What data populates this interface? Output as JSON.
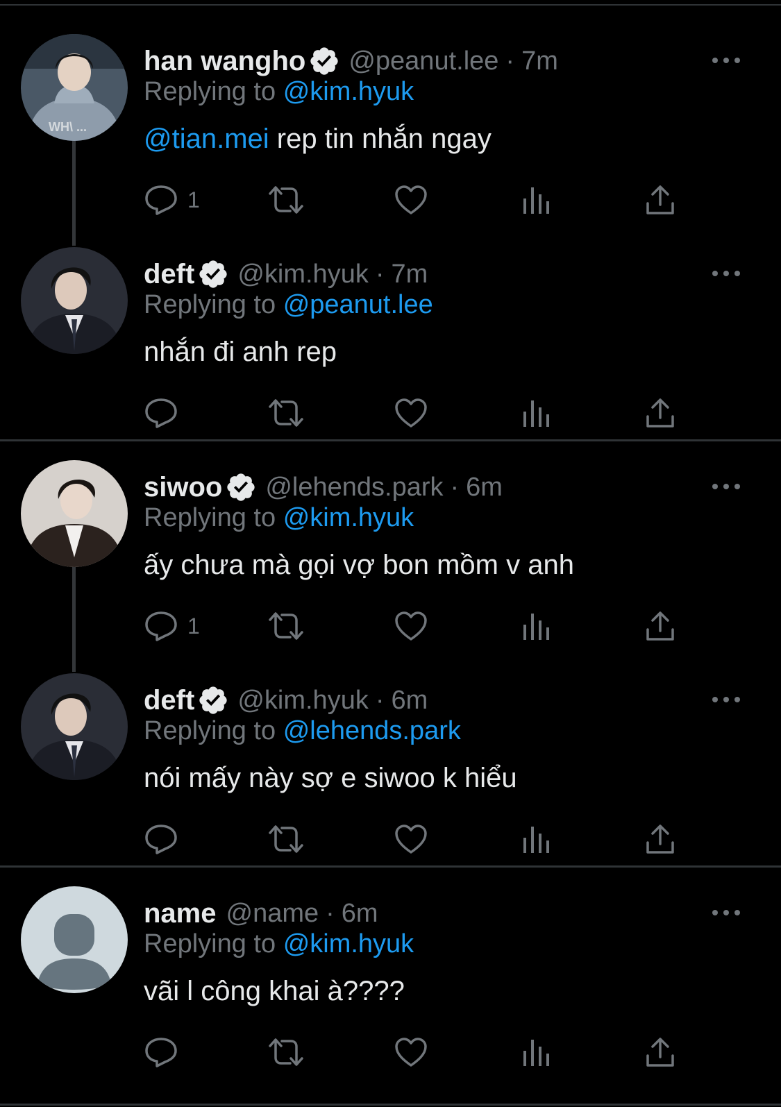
{
  "tweets": [
    {
      "name": "han wangho",
      "verified": true,
      "handle": "@peanut.lee",
      "time": "7m",
      "replying_prefix": "Replying to",
      "replying_to": "@kim.hyuk",
      "body_mention": "@tian.mei",
      "body_text": " rep tin nhắn ngay",
      "reply_count": "1",
      "avatar_icon": "user-photo-hoodie"
    },
    {
      "name": "deft",
      "verified": true,
      "handle": "@kim.hyuk",
      "time": "7m",
      "replying_prefix": "Replying to",
      "replying_to": "@peanut.lee",
      "body_text": "nhắn đi anh rep",
      "reply_count": "",
      "avatar_icon": "user-photo-suit"
    },
    {
      "name": "siwoo",
      "verified": true,
      "handle": "@lehends.park",
      "time": "6m",
      "replying_prefix": "Replying to",
      "replying_to": "@kim.hyuk",
      "body_text": "ấy chưa mà gọi vợ bon mồm v anh",
      "reply_count": "1",
      "avatar_icon": "user-photo-jacket"
    },
    {
      "name": "deft",
      "verified": true,
      "handle": "@kim.hyuk",
      "time": "6m",
      "replying_prefix": "Replying to",
      "replying_to": "@lehends.park",
      "body_text": "nói mấy này sợ e siwoo k hiểu",
      "reply_count": "",
      "avatar_icon": "user-photo-suit"
    },
    {
      "name": "name",
      "verified": false,
      "handle": "@name",
      "time": "6m",
      "replying_prefix": "Replying to",
      "replying_to": "@kim.hyuk",
      "body_text": "vãi l công khai à????",
      "reply_count": "",
      "avatar_icon": "default-avatar-placeholder"
    }
  ],
  "separator": "·",
  "colors": {
    "background": "#000000",
    "text": "#e7e9ea",
    "muted": "#71767b",
    "accent": "#1d9bf0",
    "divider": "#2f3336"
  },
  "action_icons": [
    "reply-icon",
    "retweet-icon",
    "like-icon",
    "views-icon",
    "share-icon"
  ]
}
